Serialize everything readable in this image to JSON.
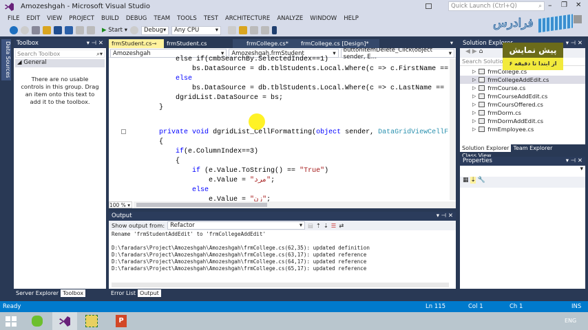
{
  "window": {
    "title": "Amozeshgah - Microsoft Visual Studio",
    "quick_launch_placeholder": "Quick Launch (Ctrl+Q)"
  },
  "menu": [
    "FILE",
    "EDIT",
    "VIEW",
    "PROJECT",
    "BUILD",
    "DEBUG",
    "TEAM",
    "TOOLS",
    "TEST",
    "ARCHITECTURE",
    "ANALYZE",
    "WINDOW",
    "HELP"
  ],
  "toolbar": {
    "start": "Start",
    "config": "Debug",
    "platform": "Any CPU"
  },
  "left_strip": {
    "label": "Data Sources"
  },
  "toolbox": {
    "title": "Toolbox",
    "search_placeholder": "Search Toolbox",
    "group": "General",
    "empty_text": "There are no usable controls in this group. Drag an item onto this text to add it to the toolbox.",
    "tabs": [
      "Server Explorer",
      "Toolbox"
    ]
  },
  "editor": {
    "tabs": [
      "frmStudent.cs",
      "frmStudent.cs [Design]",
      "frmCollege.cs*",
      "frmCollege.cs [Design]*"
    ],
    "nav": {
      "project": "Amozeshgah",
      "class": "Amozeshgah.frmStudent",
      "member": "buttonItemDelete_Click(object sender, E…"
    },
    "zoom": "100 %",
    "lines": [
      [
        [
          "        else if(cmbSearchBy.SelectedIndex==1)",
          "tx"
        ]
      ],
      [
        [
          "            bs.DataSource = db.tblStudents.Local.Where(c => c.FirstName ==",
          "tx"
        ]
      ],
      [
        [
          "        ",
          "tx"
        ],
        [
          "else",
          "kw"
        ]
      ],
      [
        [
          "            bs.DataSource = db.tblStudents.Local.Where(c => c.LastName ==",
          "tx"
        ]
      ],
      [
        [
          "        dgridList.DataSource = bs;",
          "tx"
        ]
      ],
      [
        [
          "    }",
          "tx"
        ]
      ],
      [],
      [
        [
          "    ",
          "tx"
        ],
        [
          "private",
          "kw"
        ],
        [
          " ",
          "tx"
        ],
        [
          "void",
          "kw"
        ],
        [
          " dgridList_CellFormatting(",
          "tx"
        ],
        [
          "object",
          "kw"
        ],
        [
          " sender, ",
          "tx"
        ],
        [
          "DataGridViewCellF",
          "ty"
        ]
      ],
      [
        [
          "    {",
          "tx"
        ]
      ],
      [
        [
          "        ",
          "tx"
        ],
        [
          "if",
          "kw"
        ],
        [
          "(e.ColumnIndex==3)",
          "tx"
        ]
      ],
      [
        [
          "        {",
          "tx"
        ]
      ],
      [
        [
          "            ",
          "tx"
        ],
        [
          "if",
          "kw"
        ],
        [
          " (e.Value.ToString() == ",
          "tx"
        ],
        [
          "\"True\"",
          "st"
        ],
        [
          ")",
          "tx"
        ]
      ],
      [
        [
          "                e.Value = ",
          "tx"
        ],
        [
          "\"مرد\"",
          "st"
        ],
        [
          ";",
          "tx"
        ]
      ],
      [
        [
          "            ",
          "tx"
        ],
        [
          "else",
          "kw"
        ]
      ],
      [
        [
          "                e.Value = ",
          "tx"
        ],
        [
          "\"زن\"",
          "st"
        ],
        [
          ";",
          "tx"
        ]
      ]
    ]
  },
  "output": {
    "title": "Output",
    "show_from_label": "Show output from:",
    "source": "Refactor",
    "lines": [
      "Rename 'frmStudentAddEdit' to 'frmCollegeAddEdit'",
      "",
      "D:\\faradars\\Project\\Amozeshgah\\Amozeshgah\\frmCollege.cs(62,35): updated definition",
      "D:\\faradars\\Project\\Amozeshgah\\Amozeshgah\\frmCollege.cs(63,17): updated reference",
      "D:\\faradars\\Project\\Amozeshgah\\Amozeshgah\\frmCollege.cs(64,17): updated reference",
      "D:\\faradars\\Project\\Amozeshgah\\Amozeshgah\\frmCollege.cs(65,17): updated reference"
    ],
    "tabs": [
      "Error List",
      "Output"
    ]
  },
  "solution_explorer": {
    "title": "Solution Explorer",
    "search_placeholder": "Search Solution E",
    "items": [
      "frmCollege.cs",
      "frmCollegeAddEdit.cs",
      "frmCourse.cs",
      "frmCourseAddEdit.cs",
      "frmCoursOffered.cs",
      "frmDorm.cs",
      "frmDormAddEdit.cs",
      "frmEmployee.cs",
      "frmEmployeeAddEdit.cs"
    ],
    "selected": "frmCollegeAddEdit.cs",
    "tabs": [
      "Solution Explorer",
      "Team Explorer",
      "Class View"
    ]
  },
  "properties": {
    "title": "Properties"
  },
  "overlay": {
    "logo": "فرادرس",
    "preview_title": "پیش نمایش",
    "preview_sub": "از ابتدا تا دقیقه ۶"
  },
  "status": {
    "state": "Ready",
    "ln": "Ln 115",
    "col": "Col 1",
    "ch": "Ch 1",
    "mode": "INS"
  },
  "taskbar": {
    "lang": "ENG"
  },
  "colors": {
    "accent": "#007acc",
    "vs_purple": "#68217a",
    "frame": "#293955",
    "active_tab": "#fff29d"
  }
}
